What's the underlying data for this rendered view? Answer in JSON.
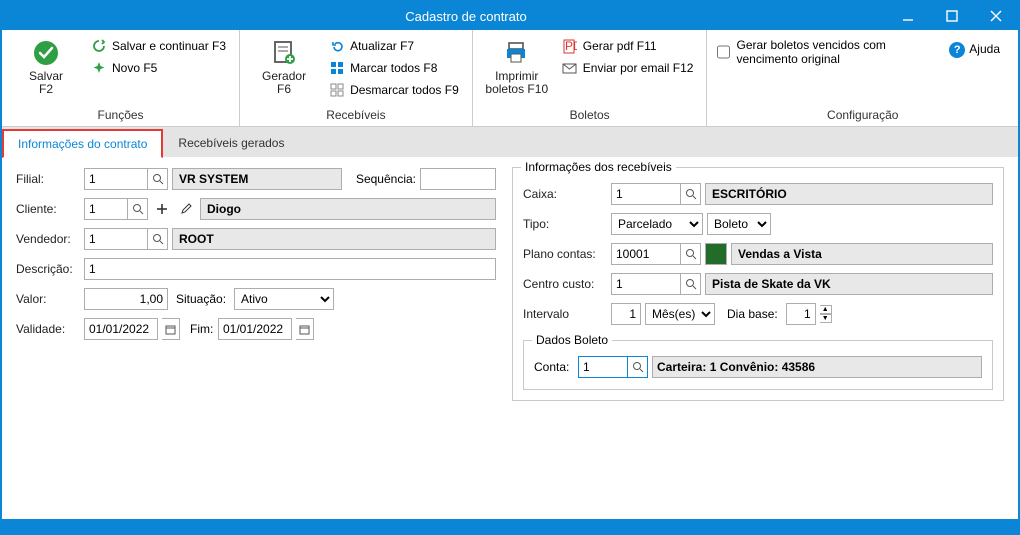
{
  "window": {
    "title": "Cadastro de contrato"
  },
  "ribbon": {
    "funcoes": {
      "label": "Funções",
      "salvar": "Salvar\nF2",
      "salvar_continuar": "Salvar e continuar F3",
      "novo": "Novo F5"
    },
    "recebiveis": {
      "label": "Recebíveis",
      "gerador": "Gerador\nF6",
      "atualizar": "Atualizar F7",
      "marcar": "Marcar todos F8",
      "desmarcar": "Desmarcar todos F9"
    },
    "boletos": {
      "label": "Boletos",
      "imprimir": "Imprimir\nboletos F10",
      "pdf": "Gerar pdf F11",
      "email": "Enviar por email F12"
    },
    "config": {
      "label": "Configuração",
      "chk": "Gerar boletos vencidos com vencimento original"
    },
    "ajuda": "Ajuda"
  },
  "tabs": {
    "a": "Informações do contrato",
    "b": "Recebíveis gerados"
  },
  "left": {
    "filial_l": "Filial:",
    "filial_v": "1",
    "filial_n": "VR SYSTEM",
    "seq_l": "Sequência:",
    "cliente_l": "Cliente:",
    "cliente_v": "1",
    "cliente_n": "Diogo",
    "vendedor_l": "Vendedor:",
    "vendedor_v": "1",
    "vendedor_n": "ROOT",
    "descricao_l": "Descrição:",
    "descricao_v": "1",
    "valor_l": "Valor:",
    "valor_v": "1,00",
    "situacao_l": "Situação:",
    "situacao_v": "Ativo",
    "validade_l": "Validade:",
    "validade_v": "01/01/2022",
    "fim_l": "Fim:",
    "fim_v": "01/01/2022"
  },
  "right": {
    "legend": "Informações dos recebíveis",
    "caixa_l": "Caixa:",
    "caixa_v": "1",
    "caixa_n": "ESCRITÓRIO",
    "tipo_l": "Tipo:",
    "tipo_v": "Parcelado",
    "tipo_sub": "Boleto",
    "plano_l": "Plano contas:",
    "plano_v": "10001",
    "plano_n": "Vendas a Vista",
    "centro_l": "Centro custo:",
    "centro_v": "1",
    "centro_n": "Pista de Skate da VK",
    "intervalo_l": "Intervalo",
    "intervalo_v": "1",
    "intervalo_u": "Mês(es)",
    "diabase_l": "Dia base:",
    "diabase_v": "1",
    "boleto_legend": "Dados Boleto",
    "conta_l": "Conta:",
    "conta_v": "1",
    "carteira": "Carteira: 1 Convênio: 43586"
  }
}
